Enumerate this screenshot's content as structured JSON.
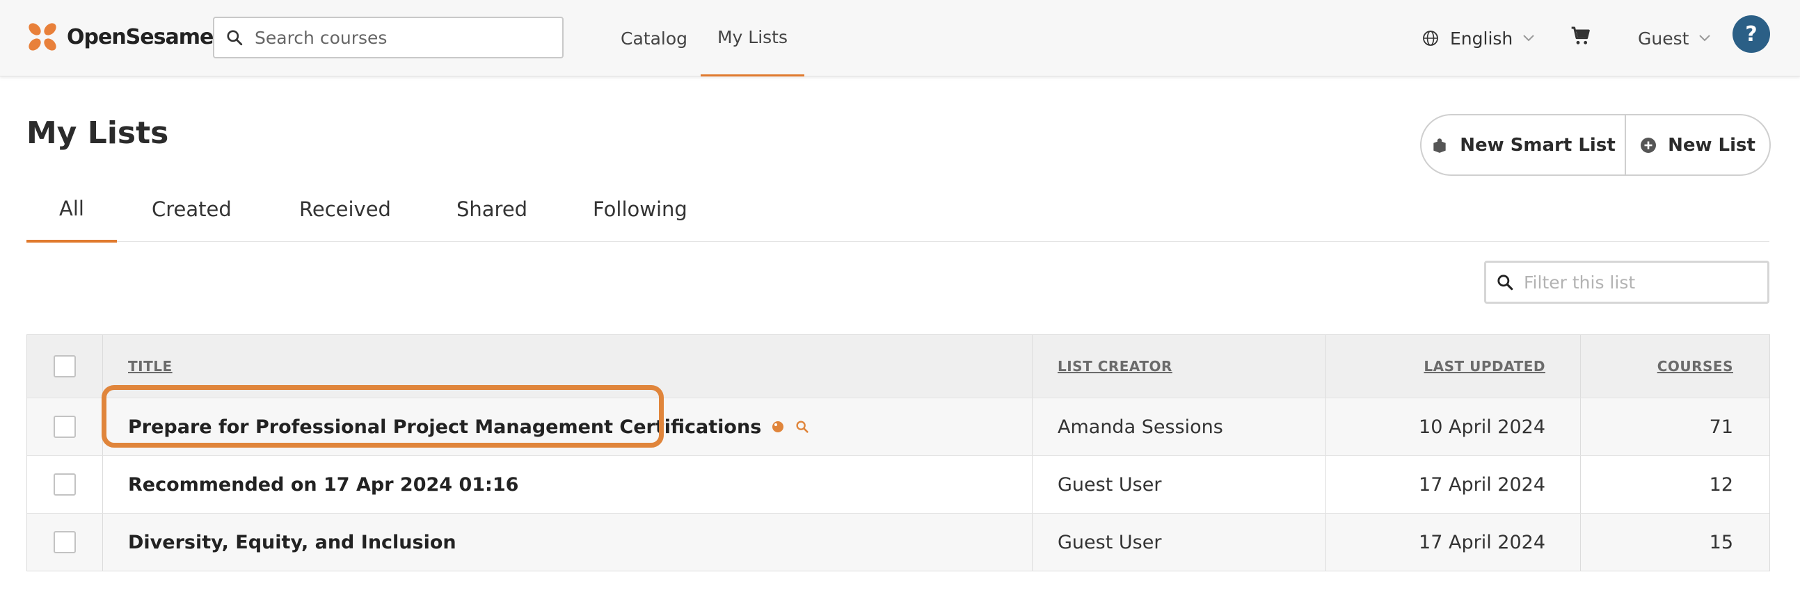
{
  "header": {
    "brand": "OpenSesame",
    "search_placeholder": "Search courses",
    "nav": {
      "catalog": "Catalog",
      "my_lists": "My Lists"
    },
    "language": "English",
    "user": "Guest",
    "help": "?"
  },
  "page": {
    "title": "My Lists",
    "actions": {
      "new_smart_list": "New Smart List",
      "new_list": "New List"
    },
    "tabs": [
      "All",
      "Created",
      "Received",
      "Shared",
      "Following"
    ],
    "active_tab": "All",
    "filter_placeholder": "Filter this list"
  },
  "table": {
    "columns": {
      "title": "TITLE",
      "creator": "LIST CREATOR",
      "updated": "LAST UPDATED",
      "courses": "COURSES"
    },
    "rows": [
      {
        "title": "Prepare for Professional Project Management Certifications",
        "creator": "Amanda Sessions",
        "updated": "10 April 2024",
        "courses": "71"
      },
      {
        "title": "Recommended on 17 Apr 2024 01:16",
        "creator": "Guest User",
        "updated": "17 April 2024",
        "courses": "12"
      },
      {
        "title": "Diversity, Equity, and Inclusion",
        "creator": "Guest User",
        "updated": "17 April 2024",
        "courses": "15"
      }
    ]
  },
  "colors": {
    "accent": "#e07a2e",
    "help_bg": "#2b5f86",
    "highlight": "#e0853b"
  },
  "icons": [
    "opensesame-logo-icon",
    "search-icon",
    "globe-icon",
    "chevron-down-icon",
    "cart-icon",
    "smart-list-icon",
    "plus-circle-icon",
    "tag-icon"
  ]
}
